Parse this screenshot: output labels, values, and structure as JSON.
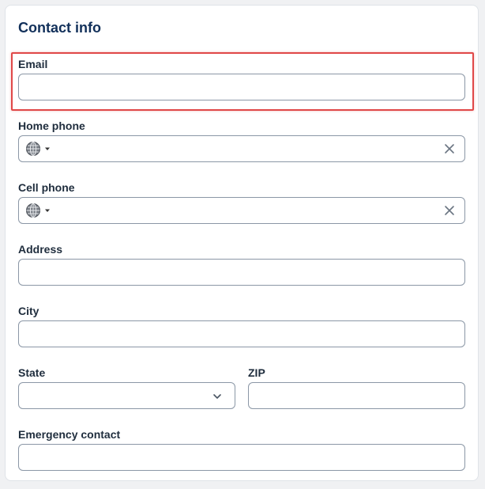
{
  "form": {
    "title": "Contact info",
    "email": {
      "label": "Email",
      "value": ""
    },
    "home_phone": {
      "label": "Home phone",
      "value": ""
    },
    "cell_phone": {
      "label": "Cell phone",
      "value": ""
    },
    "address": {
      "label": "Address",
      "value": ""
    },
    "city": {
      "label": "City",
      "value": ""
    },
    "state": {
      "label": "State",
      "selected": ""
    },
    "zip": {
      "label": "ZIP",
      "value": ""
    },
    "emergency_contact": {
      "label": "Emergency contact",
      "value": ""
    }
  },
  "icons": {
    "phone_country": "globe-icon",
    "dropdown": "caret-down-icon",
    "clear": "close-icon",
    "select": "chevron-down-icon"
  },
  "colors": {
    "title": "#12305a",
    "label": "#1f2d3d",
    "field_border": "#8b97a6",
    "highlight": "#e04848",
    "background": "#f0f1f3",
    "card": "#ffffff"
  }
}
